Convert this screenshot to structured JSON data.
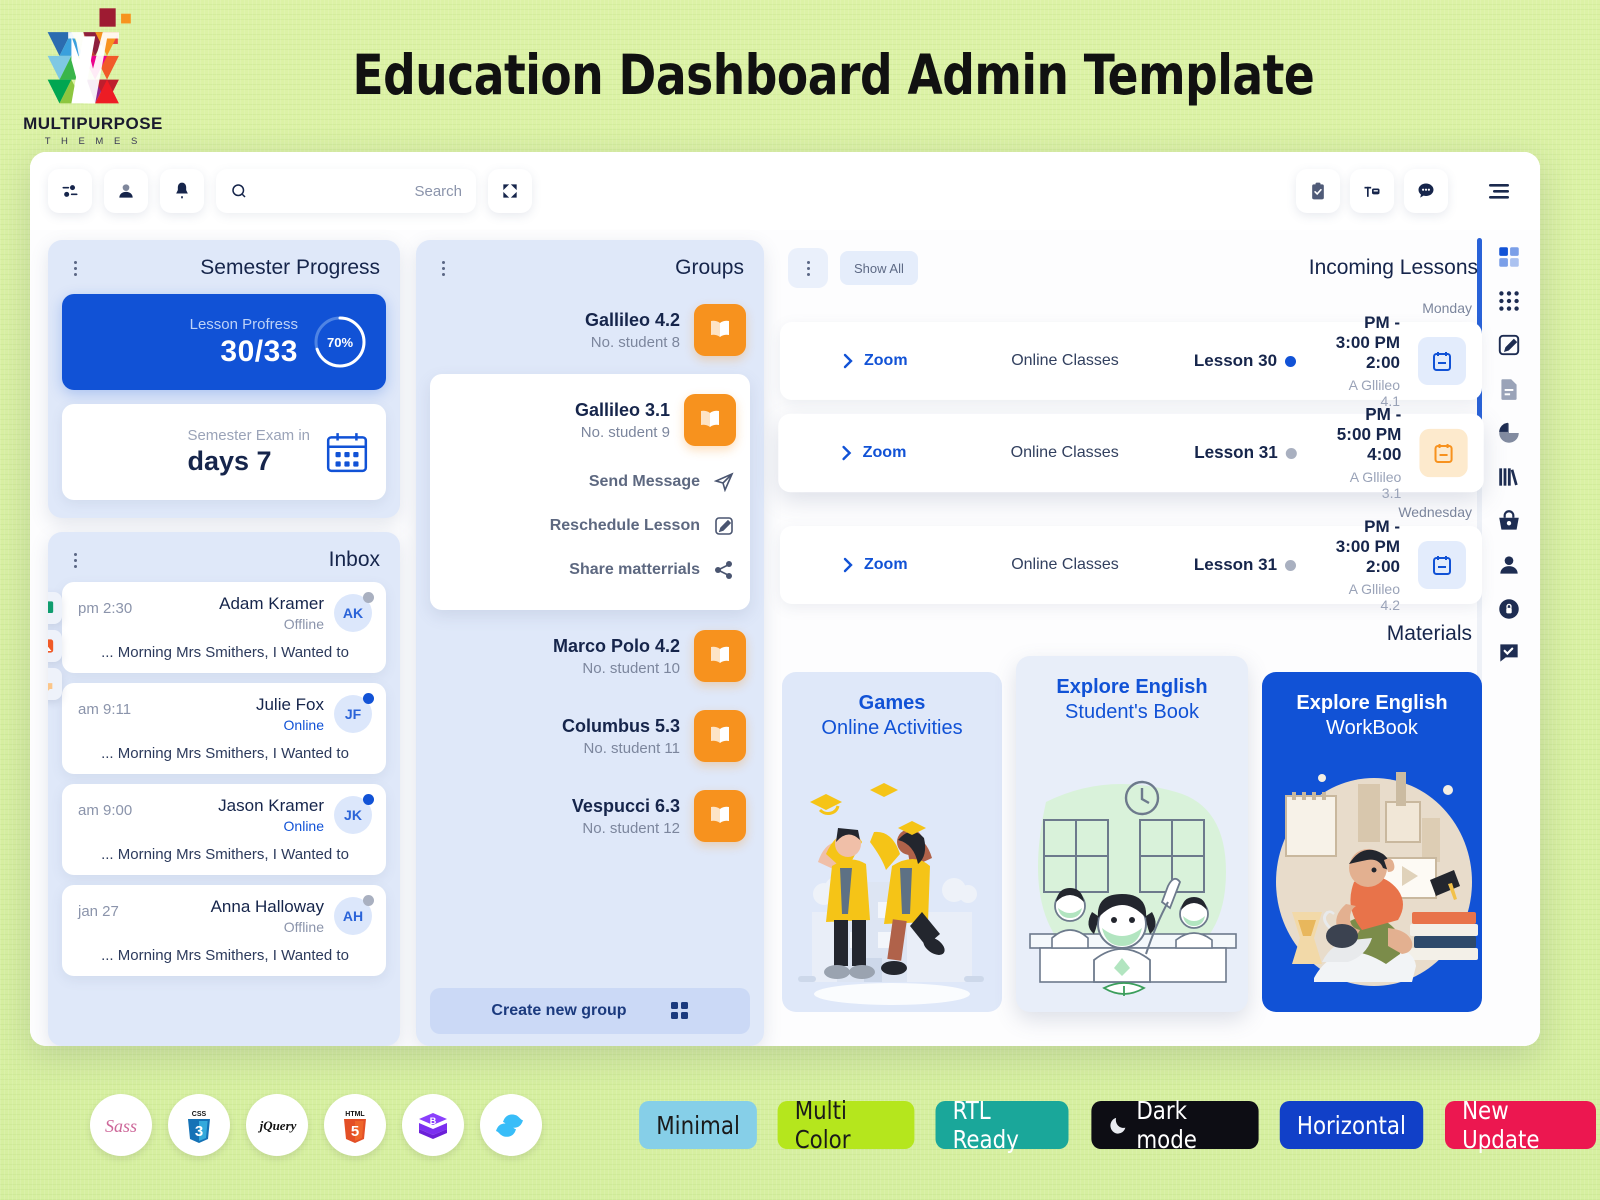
{
  "promo": {
    "title": "Education Dashboard Admin Template",
    "logo_text": "MULTIPURPOSE",
    "logo_sub": "T H E M E S"
  },
  "topbar": {
    "left_icons": [
      {
        "name": "sliders-icon",
        "label": "Settings"
      },
      {
        "name": "user-icon",
        "label": "Profile"
      },
      {
        "name": "bell-icon",
        "label": "Notifications"
      }
    ],
    "search": {
      "placeholder": "Search",
      "value": ""
    },
    "fullscreen_label": "Fullscreen",
    "right_icons": [
      {
        "name": "clipboard-check-icon",
        "label": "Tasks"
      },
      {
        "name": "card-icon",
        "label": "Cards"
      },
      {
        "name": "chat-dots-icon",
        "label": "Messages"
      }
    ],
    "menu_label": "Menu"
  },
  "rail": {
    "items": [
      {
        "name": "grid-squares-icon",
        "label": "Dashboard"
      },
      {
        "name": "apps-dots-icon",
        "label": "Apps"
      },
      {
        "name": "edit-square-icon",
        "label": "Forms"
      },
      {
        "name": "file-lines-icon",
        "label": "Pages"
      },
      {
        "name": "pie-chart-icon",
        "label": "Charts"
      },
      {
        "name": "books-icon",
        "label": "Library"
      },
      {
        "name": "basket-icon",
        "label": "Ecommerce"
      },
      {
        "name": "user-solid-icon",
        "label": "Users"
      },
      {
        "name": "lock-icon",
        "label": "Authentication"
      },
      {
        "name": "chat-check-icon",
        "label": "Support"
      }
    ]
  },
  "semester": {
    "title": "Semester Progress",
    "progress": {
      "label": "Lesson Profress",
      "value": "30/33",
      "percent": "70%",
      "percent_number": 70
    },
    "exam": {
      "label": "Semester Exam in",
      "value": "days 7",
      "icon": "calendar-icon"
    }
  },
  "inbox": {
    "title": "Inbox",
    "side_buttons": [
      {
        "name": "money-icon"
      },
      {
        "name": "image-icon"
      },
      {
        "name": "chat-bubble-icon"
      }
    ],
    "messages": [
      {
        "time": "pm 2:30",
        "name": "Adam Kramer",
        "status": "Offline",
        "online": false,
        "initials": "AK",
        "preview": "... Morning Mrs Smithers, I Wanted to"
      },
      {
        "time": "am 9:11",
        "name": "Julie Fox",
        "status": "Online",
        "online": true,
        "initials": "JF",
        "preview": "... Morning Mrs Smithers, I Wanted to"
      },
      {
        "time": "am 9:00",
        "name": "Jason Kramer",
        "status": "Online",
        "online": true,
        "initials": "JK",
        "preview": "... Morning Mrs Smithers, I Wanted to"
      },
      {
        "time": "jan 27",
        "name": "Anna Halloway",
        "status": "Offline",
        "online": false,
        "initials": "AH",
        "preview": "... Morning Mrs Smithers, I Wanted to"
      }
    ]
  },
  "groups": {
    "title": "Groups",
    "items": [
      {
        "name": "Gallileo 4.2",
        "count": "No. student 8",
        "expanded": false
      },
      {
        "name": "Gallileo 3.1",
        "count": "No. student 9",
        "expanded": true
      },
      {
        "name": "Marco Polo 4.2",
        "count": "No. student 10",
        "expanded": false
      },
      {
        "name": "Columbus 5.3",
        "count": "No. student 11",
        "expanded": false
      },
      {
        "name": "Vespucci 6.3",
        "count": "No. student 12",
        "expanded": false
      }
    ],
    "actions": [
      {
        "label": "Send Message",
        "icon": "send-icon"
      },
      {
        "label": "Reschedule Lesson",
        "icon": "edit-icon"
      },
      {
        "label": "Share matterrials",
        "icon": "share-icon"
      }
    ],
    "create_label": "Create new group",
    "create_icon": "grid-icon"
  },
  "lessons": {
    "title": "Incoming Lessons",
    "show_all_label": "Show All",
    "days": [
      {
        "label": "Monday",
        "rows": [
          {
            "zoom_label": "Zoom",
            "type": "Online Classes",
            "lesson": "Lesson 30",
            "dot": "blue",
            "time": "PM - 3:00 PM 2:00",
            "group": "A Gllileo 4.1",
            "cal_color": "blue",
            "active": false
          }
        ]
      },
      {
        "label": "",
        "rows": [
          {
            "zoom_label": "Zoom",
            "type": "Online Classes",
            "lesson": "Lesson 31",
            "dot": "grey",
            "time": "PM - 5:00 PM 4:00",
            "group": "A Gllileo 3.1",
            "cal_color": "orange",
            "active": true
          }
        ]
      },
      {
        "label": "Wednesday",
        "rows": [
          {
            "zoom_label": "Zoom",
            "type": "Online Classes",
            "lesson": "Lesson 31",
            "dot": "grey",
            "time": "PM - 3:00 PM 2:00",
            "group": "A Gllileo 4.2",
            "cal_color": "blue",
            "active": false
          }
        ]
      }
    ]
  },
  "materials": {
    "title": "Materials",
    "cards": [
      {
        "line1": "Games",
        "line2": "Online Activities",
        "theme": "light",
        "art": "graduates"
      },
      {
        "line1": "Explore English",
        "line2": "Student's Book",
        "theme": "light",
        "art": "classroom"
      },
      {
        "line1": "Explore English",
        "line2": "WorkBook",
        "theme": "blue",
        "art": "reading"
      }
    ]
  },
  "footer": {
    "tech": [
      {
        "name": "sass-logo",
        "label": "Sass"
      },
      {
        "name": "css3-logo",
        "label": "CSS3"
      },
      {
        "name": "jquery-logo",
        "label": "jQuery"
      },
      {
        "name": "html5-logo",
        "label": "HTML5"
      },
      {
        "name": "bootstrap-logo",
        "label": "Bootstrap"
      },
      {
        "name": "tailwind-logo",
        "label": "Tailwind"
      }
    ],
    "features": [
      {
        "label": "Minimal",
        "bg": "#86cfe8",
        "fg": "#1a1a1a",
        "icon": ""
      },
      {
        "label": "Multi Color",
        "bg": "#b5e61d",
        "fg": "#1a1a1a",
        "icon": ""
      },
      {
        "label": "RTL Ready",
        "bg": "#1aa79a",
        "fg": "#ffffff",
        "icon": ""
      },
      {
        "label": "Dark mode",
        "bg": "#0d0d14",
        "fg": "#ffffff",
        "icon": "moon-icon"
      },
      {
        "label": "Horizontal",
        "bg": "#1140c8",
        "fg": "#ffffff",
        "icon": ""
      },
      {
        "label": "New Update",
        "bg": "#ec1750",
        "fg": "#ffffff",
        "icon": ""
      }
    ]
  }
}
